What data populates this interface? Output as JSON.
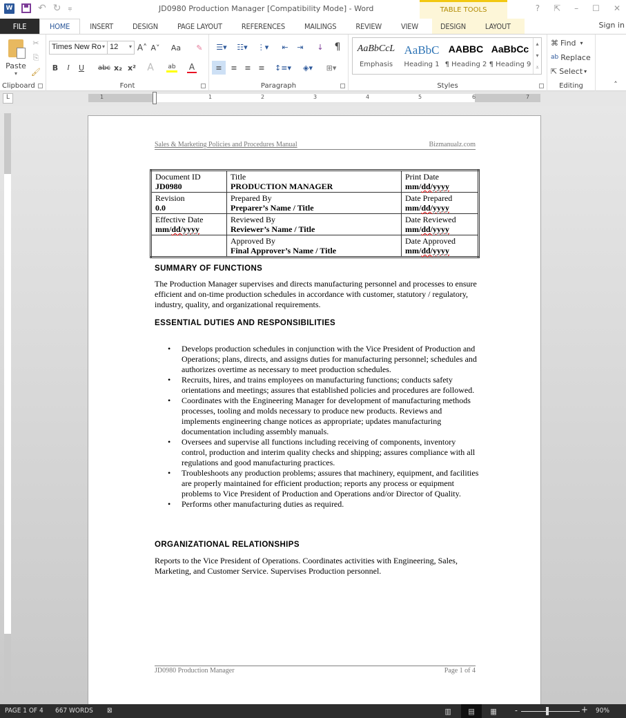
{
  "app": {
    "window_title": "JD0980 Production Manager [Compatibility Mode] - Word",
    "context_tab_group": "TABLE TOOLS",
    "sign_in": "Sign in",
    "window_controls": [
      "?",
      "⇱",
      "–",
      "☐",
      "✕"
    ]
  },
  "quick_access": {
    "icons": [
      "word-icon",
      "save-icon",
      "undo-icon",
      "redo-icon",
      "customize-icon"
    ],
    "undo": "↶",
    "redo": "↻",
    "customize": "⩦"
  },
  "tabs": [
    {
      "label": "FILE"
    },
    {
      "label": "HOME",
      "active": true
    },
    {
      "label": "INSERT"
    },
    {
      "label": "DESIGN"
    },
    {
      "label": "PAGE LAYOUT"
    },
    {
      "label": "REFERENCES"
    },
    {
      "label": "MAILINGS"
    },
    {
      "label": "REVIEW"
    },
    {
      "label": "VIEW"
    },
    {
      "label": "DESIGN",
      "contextual": true
    },
    {
      "label": "LAYOUT",
      "contextual": true
    }
  ],
  "ribbon": {
    "clipboard": {
      "label": "Clipboard",
      "paste": "Paste"
    },
    "font": {
      "label": "Font",
      "font_name": "Times New Ro",
      "font_size": "12",
      "bold": "B",
      "italic": "I",
      "underline": "U",
      "strike": "abc",
      "subscript": "x₂",
      "superscript": "x²",
      "grow": "A˄",
      "shrink": "A˅",
      "case": "Aa",
      "highlight_color": "#ffff00",
      "font_color": "#e81123"
    },
    "paragraph": {
      "label": "Paragraph",
      "pilcrow": "¶"
    },
    "styles": {
      "label": "Styles",
      "items": [
        {
          "preview": "AaBbCcL",
          "name": "Emphasis"
        },
        {
          "preview": "AaBbC",
          "name": "Heading 1"
        },
        {
          "preview": "AABBC",
          "name": "¶ Heading 2"
        },
        {
          "preview": "AaBbCc",
          "name": "¶ Heading 9"
        }
      ]
    },
    "editing": {
      "label": "Editing",
      "find": "Find",
      "replace": "Replace",
      "select": "Select"
    },
    "collapse": "˄"
  },
  "ruler": {
    "corner": "L",
    "numbers": [
      "1",
      "1",
      "2",
      "3",
      "4",
      "5",
      "6",
      "7"
    ]
  },
  "document": {
    "header_left": "Sales & Marketing Policies and Procedures Manual",
    "header_right": "Bizmanualz.com",
    "info_table": [
      [
        {
          "label": "Document ID",
          "value": "JD0980"
        },
        {
          "label": "Title",
          "value": "PRODUCTION MANAGER"
        },
        {
          "label": "Print Date",
          "value": "mm/dd/yyyy"
        }
      ],
      [
        {
          "label": "Revision",
          "value": "0.0"
        },
        {
          "label": "Prepared By",
          "value": "Preparer’s Name / Title"
        },
        {
          "label": "Date Prepared",
          "value": "mm/dd/yyyy"
        }
      ],
      [
        {
          "label": "Effective Date",
          "value": "mm/dd/yyyy"
        },
        {
          "label": "Reviewed By",
          "value": "Reviewer’s Name / Title"
        },
        {
          "label": "Date Reviewed",
          "value": "mm/dd/yyyy"
        }
      ],
      [
        {
          "label": "",
          "value": ""
        },
        {
          "label": "Approved By",
          "value": "Final Approver’s Name / Title"
        },
        {
          "label": "Date Approved",
          "value": "mm/dd/yyyy"
        }
      ]
    ],
    "summary_heading": "SUMMARY OF FUNCTIONS",
    "summary_text": "The Production Manager supervises and directs manufacturing personnel and processes to ensure efficient and on-time production schedules in accordance with customer, statutory / regulatory, industry, quality, and organizational requirements.",
    "duties_heading": "ESSENTIAL DUTIES AND RESPONSIBILITIES",
    "duties": [
      "Develops production schedules in conjunction with the Vice President of Production and Operations; plans, directs, and assigns duties for manufacturing personnel; schedules and authorizes overtime as necessary to meet production schedules.",
      "Recruits, hires, and trains employees on manufacturing functions; conducts safety orientations and meetings; assures that established policies and procedures are followed.",
      "Coordinates with the Engineering Manager for development of manufacturing methods processes, tooling and molds necessary to produce new products. Reviews and implements engineering change notices as appropriate; updates manufacturing documentation including assembly manuals.",
      "Oversees and supervise all functions including receiving of components, inventory control, production and interim quality checks and shipping; assures compliance with all regulations and good manufacturing practices.",
      "Troubleshoots any production problems; assures that machinery, equipment, and facilities are properly maintained for efficient production; reports any process or equipment problems to Vice President of Production and Operations and/or Director of Quality.",
      "Performs other manufacturing duties as required."
    ],
    "org_heading": "ORGANIZATIONAL RELATIONSHIPS",
    "org_text": "Reports to the Vice President of Operations. Coordinates activities with Engineering, Sales, Marketing, and Customer Service. Supervises Production personnel.",
    "footer_left": "JD0980 Production Manager",
    "footer_right": "Page 1 of 4"
  },
  "status": {
    "page": "PAGE 1 OF 4",
    "words": "667 WORDS",
    "zoom_minus": "-",
    "zoom_plus": "+",
    "zoom_level": "90%",
    "zoom_percent_value": 90
  }
}
